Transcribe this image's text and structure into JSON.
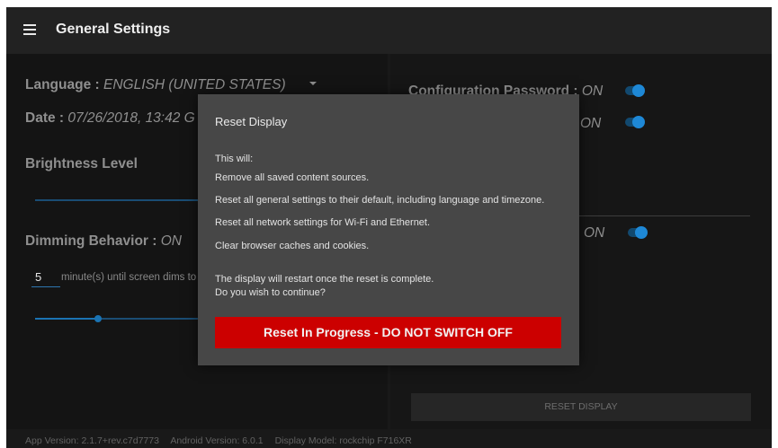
{
  "header": {
    "title": "General Settings",
    "menu_icon": "hamburger-menu-icon"
  },
  "left": {
    "language_label": "Language : ",
    "language_value": "ENGLISH (UNITED STATES)",
    "date_label": "Date : ",
    "date_value": "07/26/2018, 13:42 G",
    "brightness_label": "Brightness Level",
    "dimming_label": "Dimming Behavior : ",
    "dimming_value": "ON",
    "minutes_value": "5",
    "minutes_text": "minute(s) until screen dims to"
  },
  "right": {
    "config_password_label": "Configuration Password : ",
    "config_password_value": "ON",
    "row2_value": "ON",
    "row3_value": "ON",
    "reset_button": "RESET DISPLAY"
  },
  "dialog": {
    "title": "Reset Display",
    "lines": [
      "This will:",
      "Remove all saved content sources.",
      "Reset all general settings to their default, including language and timezone.",
      "Reset all network settings for Wi-Fi and Ethernet.",
      "Clear browser caches and cookies.",
      "The display will restart once the reset is complete.",
      "Do you wish to continue?"
    ],
    "progress_button": "Reset In Progress - DO NOT SWITCH OFF"
  },
  "footer": {
    "app_version": "App Version: 2.1.7+rev.c7d7773",
    "android_version": "Android Version: 6.0.1",
    "display_model": "Display Model: rockchip F716XR"
  },
  "colors": {
    "accent": "#1e88d6",
    "danger": "#cc0000",
    "background": "#191919"
  }
}
